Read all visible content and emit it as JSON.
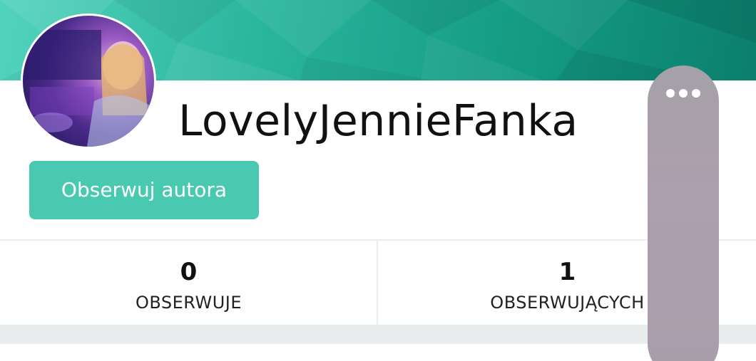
{
  "profile": {
    "username": "LovelyJennieFanka",
    "follow_label": "Obserwuj autora"
  },
  "stats": {
    "following": {
      "value": "0",
      "label": "OBSERWUJE"
    },
    "followers": {
      "value": "1",
      "label": "OBSERWUJĄCYCH"
    }
  },
  "icons": {
    "more": "more-horizontal-icon"
  },
  "colors": {
    "accent": "#48c9b0",
    "cover_start": "#52d3bd",
    "cover_end": "#0b7f6c",
    "more_pill": "#a9a0ab"
  }
}
